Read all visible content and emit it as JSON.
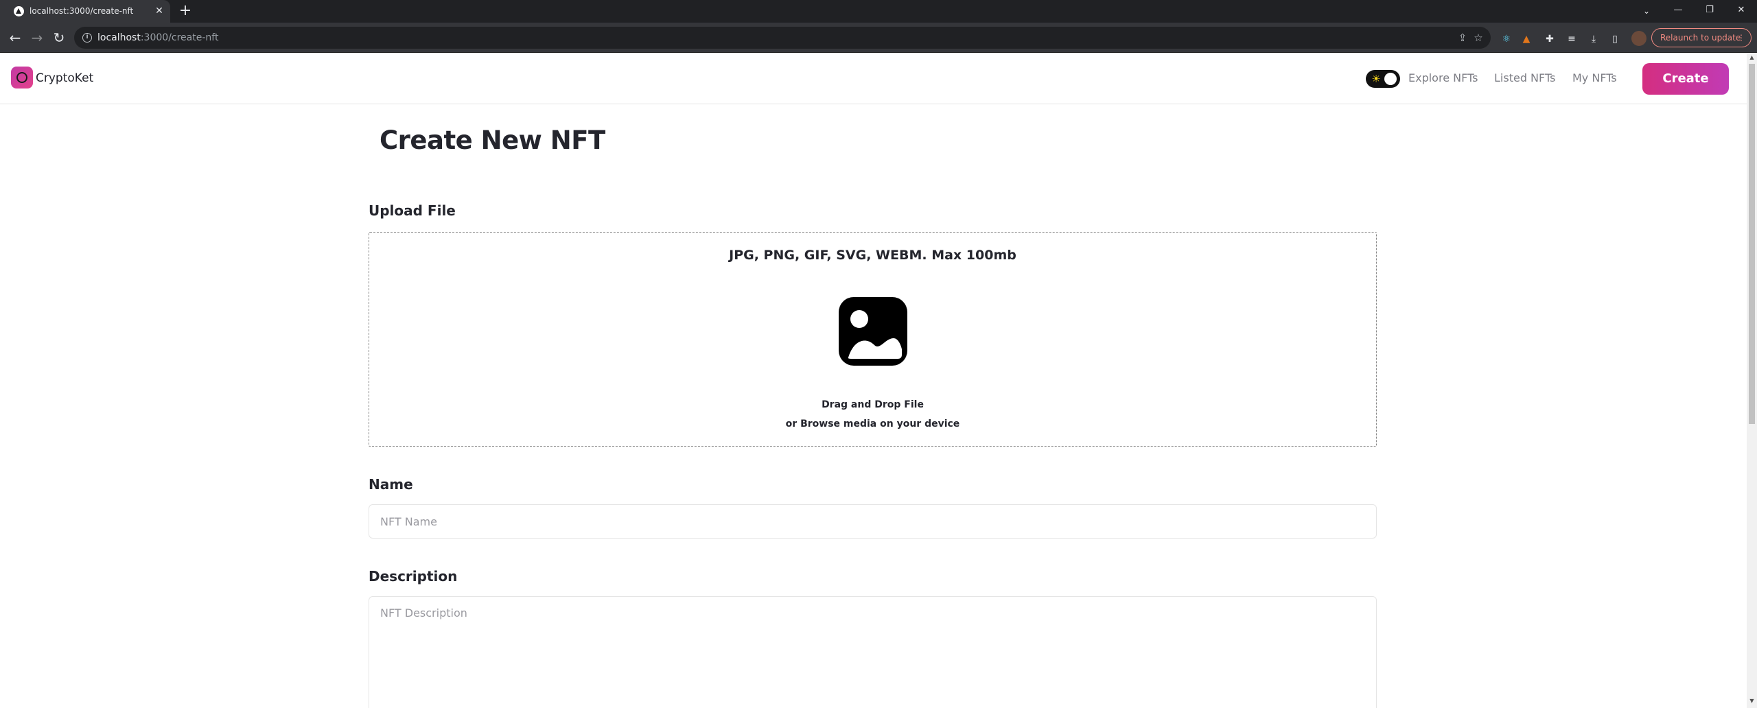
{
  "browser": {
    "tab_title": "localhost:3000/create-nft",
    "url_host": "localhost",
    "url_path": ":3000/create-nft",
    "relaunch_label": "Relaunch to update"
  },
  "navbar": {
    "brand": "CryptoKet",
    "links": [
      "Explore NFTs",
      "Listed NFTs",
      "My NFTs"
    ],
    "create_label": "Create"
  },
  "main": {
    "title": "Create New NFT",
    "upload": {
      "label": "Upload File",
      "formats": "JPG, PNG, GIF, SVG, WEBM. Max 100mb",
      "drag_text": "Drag and Drop File",
      "browse_text": "or Browse media on your device"
    },
    "name": {
      "label": "Name",
      "value": "",
      "placeholder": "NFT Name"
    },
    "description": {
      "label": "Description",
      "value": "",
      "placeholder": "NFT Description"
    }
  },
  "colors": {
    "accent_start": "#d42e80",
    "accent_end": "#c13bb5",
    "text_primary": "#24252d",
    "text_muted": "#7d7e85"
  }
}
